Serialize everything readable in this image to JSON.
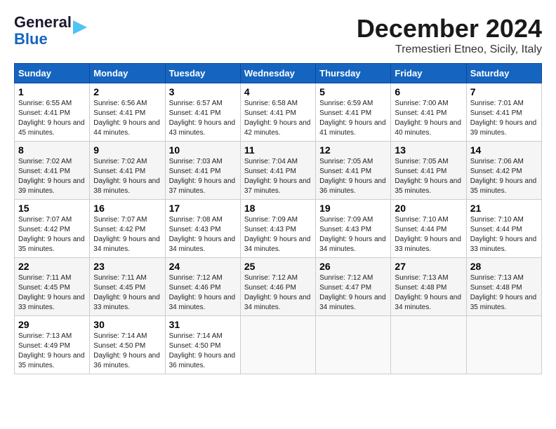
{
  "header": {
    "logo_line1": "General",
    "logo_line2": "Blue",
    "month": "December 2024",
    "subtitle": "Tremestieri Etneo, Sicily, Italy"
  },
  "days_of_week": [
    "Sunday",
    "Monday",
    "Tuesday",
    "Wednesday",
    "Thursday",
    "Friday",
    "Saturday"
  ],
  "weeks": [
    [
      {
        "day": "1",
        "sunrise": "6:55 AM",
        "sunset": "4:41 PM",
        "daylight": "9 hours and 45 minutes."
      },
      {
        "day": "2",
        "sunrise": "6:56 AM",
        "sunset": "4:41 PM",
        "daylight": "9 hours and 44 minutes."
      },
      {
        "day": "3",
        "sunrise": "6:57 AM",
        "sunset": "4:41 PM",
        "daylight": "9 hours and 43 minutes."
      },
      {
        "day": "4",
        "sunrise": "6:58 AM",
        "sunset": "4:41 PM",
        "daylight": "9 hours and 42 minutes."
      },
      {
        "day": "5",
        "sunrise": "6:59 AM",
        "sunset": "4:41 PM",
        "daylight": "9 hours and 41 minutes."
      },
      {
        "day": "6",
        "sunrise": "7:00 AM",
        "sunset": "4:41 PM",
        "daylight": "9 hours and 40 minutes."
      },
      {
        "day": "7",
        "sunrise": "7:01 AM",
        "sunset": "4:41 PM",
        "daylight": "9 hours and 39 minutes."
      }
    ],
    [
      {
        "day": "8",
        "sunrise": "7:02 AM",
        "sunset": "4:41 PM",
        "daylight": "9 hours and 39 minutes."
      },
      {
        "day": "9",
        "sunrise": "7:02 AM",
        "sunset": "4:41 PM",
        "daylight": "9 hours and 38 minutes."
      },
      {
        "day": "10",
        "sunrise": "7:03 AM",
        "sunset": "4:41 PM",
        "daylight": "9 hours and 37 minutes."
      },
      {
        "day": "11",
        "sunrise": "7:04 AM",
        "sunset": "4:41 PM",
        "daylight": "9 hours and 37 minutes."
      },
      {
        "day": "12",
        "sunrise": "7:05 AM",
        "sunset": "4:41 PM",
        "daylight": "9 hours and 36 minutes."
      },
      {
        "day": "13",
        "sunrise": "7:05 AM",
        "sunset": "4:41 PM",
        "daylight": "9 hours and 35 minutes."
      },
      {
        "day": "14",
        "sunrise": "7:06 AM",
        "sunset": "4:42 PM",
        "daylight": "9 hours and 35 minutes."
      }
    ],
    [
      {
        "day": "15",
        "sunrise": "7:07 AM",
        "sunset": "4:42 PM",
        "daylight": "9 hours and 35 minutes."
      },
      {
        "day": "16",
        "sunrise": "7:07 AM",
        "sunset": "4:42 PM",
        "daylight": "9 hours and 34 minutes."
      },
      {
        "day": "17",
        "sunrise": "7:08 AM",
        "sunset": "4:43 PM",
        "daylight": "9 hours and 34 minutes."
      },
      {
        "day": "18",
        "sunrise": "7:09 AM",
        "sunset": "4:43 PM",
        "daylight": "9 hours and 34 minutes."
      },
      {
        "day": "19",
        "sunrise": "7:09 AM",
        "sunset": "4:43 PM",
        "daylight": "9 hours and 34 minutes."
      },
      {
        "day": "20",
        "sunrise": "7:10 AM",
        "sunset": "4:44 PM",
        "daylight": "9 hours and 33 minutes."
      },
      {
        "day": "21",
        "sunrise": "7:10 AM",
        "sunset": "4:44 PM",
        "daylight": "9 hours and 33 minutes."
      }
    ],
    [
      {
        "day": "22",
        "sunrise": "7:11 AM",
        "sunset": "4:45 PM",
        "daylight": "9 hours and 33 minutes."
      },
      {
        "day": "23",
        "sunrise": "7:11 AM",
        "sunset": "4:45 PM",
        "daylight": "9 hours and 33 minutes."
      },
      {
        "day": "24",
        "sunrise": "7:12 AM",
        "sunset": "4:46 PM",
        "daylight": "9 hours and 34 minutes."
      },
      {
        "day": "25",
        "sunrise": "7:12 AM",
        "sunset": "4:46 PM",
        "daylight": "9 hours and 34 minutes."
      },
      {
        "day": "26",
        "sunrise": "7:12 AM",
        "sunset": "4:47 PM",
        "daylight": "9 hours and 34 minutes."
      },
      {
        "day": "27",
        "sunrise": "7:13 AM",
        "sunset": "4:48 PM",
        "daylight": "9 hours and 34 minutes."
      },
      {
        "day": "28",
        "sunrise": "7:13 AM",
        "sunset": "4:48 PM",
        "daylight": "9 hours and 35 minutes."
      }
    ],
    [
      {
        "day": "29",
        "sunrise": "7:13 AM",
        "sunset": "4:49 PM",
        "daylight": "9 hours and 35 minutes."
      },
      {
        "day": "30",
        "sunrise": "7:14 AM",
        "sunset": "4:50 PM",
        "daylight": "9 hours and 36 minutes."
      },
      {
        "day": "31",
        "sunrise": "7:14 AM",
        "sunset": "4:50 PM",
        "daylight": "9 hours and 36 minutes."
      },
      null,
      null,
      null,
      null
    ]
  ]
}
